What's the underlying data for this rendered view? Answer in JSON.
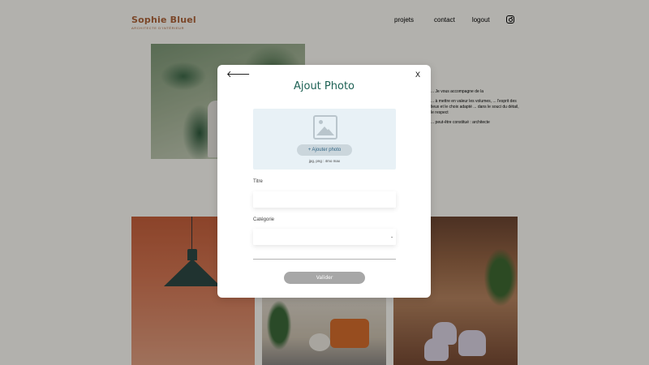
{
  "header": {
    "logo_name": "Sophie Bluel",
    "logo_subtitle": "Architecte d'intérieur",
    "nav": [
      "projets",
      "contact",
      "logout"
    ],
    "instagram_icon": "instagram-icon"
  },
  "intro": {
    "lines": [
      "... Je vous accompagne de la",
      "... à mettre en valeur les volumes, ... l'esprit des lieux et le choix adapté ... dans le souci du détail, le respect",
      "... peut-être constitué : architecte"
    ]
  },
  "modal": {
    "back_icon": "arrow-left-icon",
    "back_glyph": "🡐",
    "close_label": "X",
    "title": "Ajout Photo",
    "upload": {
      "image_icon": "image-icon",
      "add_button_label": "+ Ajouter photo",
      "hint": "jpg, png : 4mo max"
    },
    "fields": {
      "title_label": "Titre",
      "title_value": "",
      "category_label": "Catégorie",
      "category_value": "",
      "category_chevron": "⌄"
    },
    "submit_label": "Valider"
  },
  "colors": {
    "brand": "#b1663c",
    "title_green": "#1d6154",
    "upload_bg": "#e8f1f6",
    "submit_disabled": "#a7a7a7"
  }
}
